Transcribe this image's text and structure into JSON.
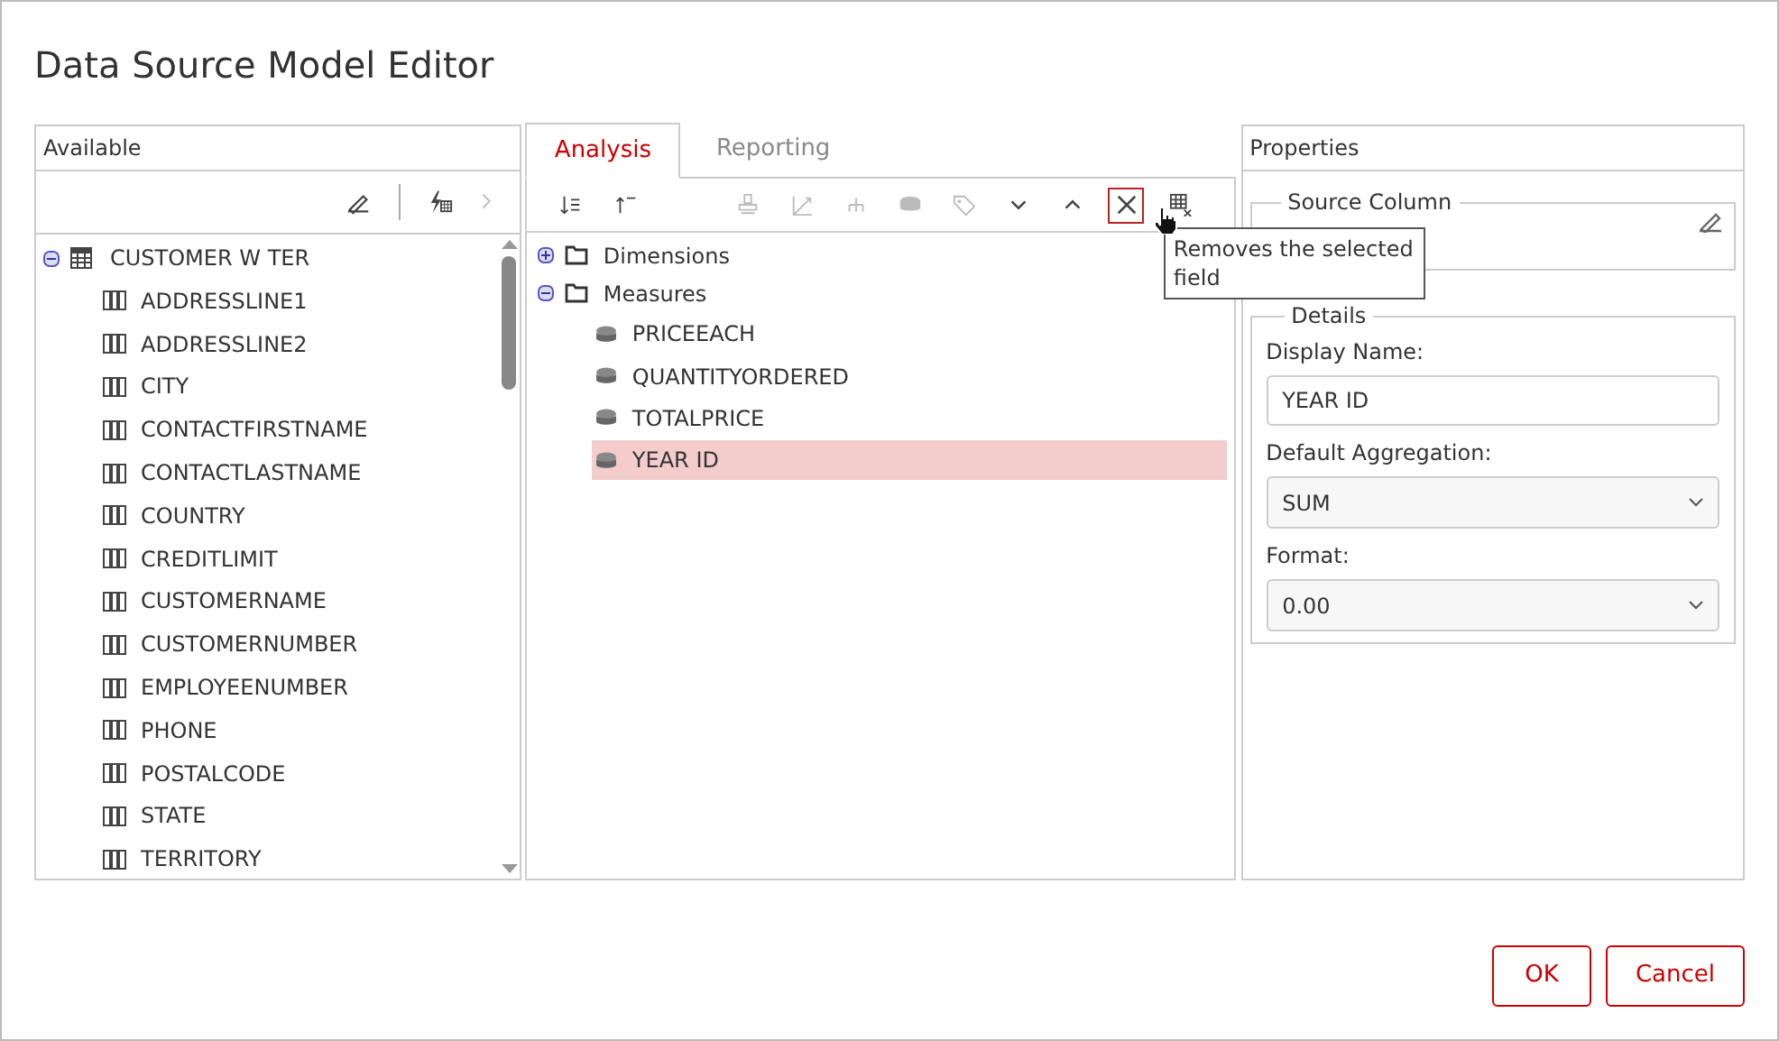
{
  "window": {
    "title": "Data Source Model Editor"
  },
  "available": {
    "title": "Available",
    "toolbar": [
      {
        "disabled": false
      },
      {
        "disabled": false
      },
      {
        "disabled": true
      }
    ],
    "tree": [
      {
        "label": "CUSTOMER W TER",
        "expanded": true,
        "children": [
          {
            "label": "ADDRESSLINE1"
          },
          {
            "label": "ADDRESSLINE2"
          },
          {
            "label": "CITY"
          },
          {
            "label": "CONTACTFIRSTNAME"
          },
          {
            "label": "CONTACTLASTNAME"
          },
          {
            "label": "COUNTRY"
          },
          {
            "label": "CREDITLIMIT"
          },
          {
            "label": "CUSTOMERNAME"
          },
          {
            "label": "CUSTOMERNUMBER"
          },
          {
            "label": "EMPLOYEENUMBER"
          },
          {
            "label": "PHONE"
          },
          {
            "label": "POSTALCODE"
          },
          {
            "label": "STATE"
          },
          {
            "label": "TERRITORY"
          }
        ]
      }
    ]
  },
  "model": {
    "tabs": [
      {
        "label": "Analysis",
        "selected": true
      },
      {
        "label": "Reporting",
        "selected": false
      }
    ],
    "toolbar": [
      {
        "disabled": false,
        "hovered": false
      },
      {
        "disabled": false,
        "hovered": false
      },
      {
        "disabled": true,
        "hovered": false
      },
      {
        "disabled": true,
        "hovered": false
      },
      {
        "disabled": true,
        "hovered": false
      },
      {
        "disabled": true,
        "hovered": false
      },
      {
        "disabled": true,
        "hovered": false
      },
      {
        "disabled": false,
        "hovered": false
      },
      {
        "disabled": false,
        "hovered": false
      },
      {
        "disabled": false,
        "hovered": true
      },
      {
        "disabled": false,
        "hovered": false
      }
    ],
    "tree": [
      {
        "label": "Dimensions",
        "expanded": false
      },
      {
        "label": "Measures",
        "expanded": true,
        "children": [
          {
            "label": "PRICEEACH",
            "selected": false
          },
          {
            "label": "QUANTITYORDERED",
            "selected": false
          },
          {
            "label": "TOTALPRICE",
            "selected": false
          },
          {
            "label": "YEAR ID",
            "selected": true
          }
        ]
      }
    ],
    "tooltip": "Removes the selected field"
  },
  "properties": {
    "title": "Properties",
    "source_column": {
      "legend": "Source Column"
    },
    "details": {
      "legend": "Details",
      "display_name": {
        "label": "Display Name:",
        "value": "YEAR ID"
      },
      "default_aggregation": {
        "label": "Default Aggregation:",
        "value": "SUM"
      },
      "format": {
        "label": "Format:",
        "value": "0.00"
      }
    }
  },
  "buttons": [
    {
      "label": "OK"
    },
    {
      "label": "Cancel"
    }
  ]
}
